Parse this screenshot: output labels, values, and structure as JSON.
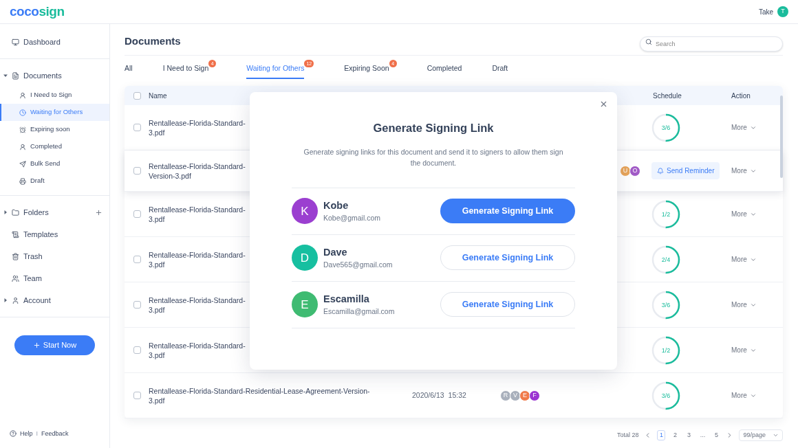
{
  "header": {
    "logo_left": "coco",
    "logo_right": "sign",
    "user_name": "Take",
    "user_initial": "T"
  },
  "sidebar": {
    "items": [
      {
        "label": "Dashboard",
        "kind": "link",
        "selected": false
      },
      {
        "label": "Documents",
        "kind": "group",
        "expanded": true,
        "children": [
          {
            "label": "I Need to Sign",
            "selected": false
          },
          {
            "label": "Waiting for Others",
            "selected": true
          },
          {
            "label": "Expiring soon",
            "selected": false
          },
          {
            "label": "Completed",
            "selected": false
          },
          {
            "label": "Bulk Send",
            "selected": false
          },
          {
            "label": "Draft",
            "selected": false
          }
        ]
      },
      {
        "label": "Folders",
        "kind": "group",
        "expanded": false,
        "addable": true
      },
      {
        "label": "Templates",
        "kind": "link",
        "selected": false
      },
      {
        "label": "Trash",
        "kind": "link",
        "selected": false
      },
      {
        "label": "Team",
        "kind": "link",
        "selected": false
      },
      {
        "label": "Account",
        "kind": "group",
        "expanded": false
      }
    ],
    "start_button": "Start Now",
    "help": "Help",
    "separator": "I",
    "feedback": "Feedback"
  },
  "page": {
    "title": "Documents",
    "search": {
      "placeholder": "Search"
    }
  },
  "tabs": [
    {
      "label": "All",
      "selected": false
    },
    {
      "label": "I Need to Sign",
      "badge": "4",
      "selected": false
    },
    {
      "label": "Waiting for Others",
      "badge": "12",
      "selected": true
    },
    {
      "label": "Expiring Soon",
      "badge": "4",
      "selected": false
    },
    {
      "label": "Completed",
      "selected": false
    },
    {
      "label": "Draft",
      "selected": false
    }
  ],
  "table": {
    "header": {
      "name": "Name",
      "schedule": "Schedule",
      "action": "Action",
      "all_checked": false
    },
    "rows": [
      {
        "name_lines": [
          "Rentallease-Florida-Standard-",
          "3.pdf"
        ],
        "checked": false,
        "schedule": {
          "kind": "ring",
          "reading": "3/6"
        },
        "action": "More",
        "highlighted": false
      },
      {
        "name_lines": [
          "Rentallease-Florida-Standard-",
          "Version-3.pdf"
        ],
        "checked": false,
        "recipients": [
          {
            "initial": "U",
            "color": "#e9a55a"
          },
          {
            "initial": "O",
            "color": "#a25bc7"
          }
        ],
        "schedule": {
          "kind": "reminder",
          "label": "Send Reminder"
        },
        "action": "More",
        "highlighted": true
      },
      {
        "name_lines": [
          "Rentallease-Florida-Standard-",
          "3.pdf"
        ],
        "checked": false,
        "schedule": {
          "kind": "ring",
          "reading": "1/2"
        },
        "action": "More",
        "highlighted": false
      },
      {
        "name_lines": [
          "Rentallease-Florida-Standard-",
          "3.pdf"
        ],
        "checked": false,
        "schedule": {
          "kind": "ring",
          "reading": "2/4"
        },
        "action": "More",
        "highlighted": false
      },
      {
        "name_lines": [
          "Rentallease-Florida-Standard-",
          "3.pdf"
        ],
        "checked": false,
        "schedule": {
          "kind": "ring",
          "reading": "3/6"
        },
        "action": "More",
        "highlighted": false
      },
      {
        "name_lines": [
          "Rentallease-Florida-Standard-",
          "3.pdf"
        ],
        "checked": false,
        "schedule": {
          "kind": "ring",
          "reading": "1/2"
        },
        "action": "More",
        "highlighted": false
      },
      {
        "name_lines": [
          "Rentallease-Florida-Standard-Residential-Lease-Agreement-Version-",
          "3.pdf"
        ],
        "checked": false,
        "date": "2020/6/13  15:32",
        "recipients": [
          {
            "initial": "R",
            "color": "#a9b0bc"
          },
          {
            "initial": "V",
            "color": "#a9b0bc"
          },
          {
            "initial": "E",
            "color": "#f07a4a"
          },
          {
            "initial": "F",
            "color": "#9b35d1"
          }
        ],
        "schedule": {
          "kind": "ring",
          "reading": "3/6"
        },
        "action": "More",
        "highlighted": false
      }
    ]
  },
  "pagination": {
    "total": "Total 28",
    "pages": [
      {
        "label": "1",
        "selected": true
      },
      {
        "label": "2",
        "selected": false
      },
      {
        "label": "3",
        "selected": false
      },
      {
        "label": "...",
        "selected": false
      },
      {
        "label": "5",
        "selected": false
      }
    ],
    "page_size": "99/page"
  },
  "modal": {
    "title": "Generate Signing Link",
    "description": "Generate signing links for this document and send it to signers to allow them sign the document.",
    "signers": [
      {
        "initial": "K",
        "name": "Kobe",
        "email": "Kobe@gmail.com",
        "color": "#9b3fd0",
        "button": {
          "label": "Generate Signing Link",
          "kind": "filled"
        }
      },
      {
        "initial": "D",
        "name": "Dave",
        "email": "Dave565@gmail.com",
        "color": "#17bfa0",
        "button": {
          "label": "Generate Signing Link",
          "kind": "outline"
        }
      },
      {
        "initial": "E",
        "name": "Escamilla",
        "email": "Escamilla@gmail.com",
        "color": "#3fbb72",
        "button": {
          "label": "Generate Signing Link",
          "kind": "outline"
        }
      }
    ]
  }
}
